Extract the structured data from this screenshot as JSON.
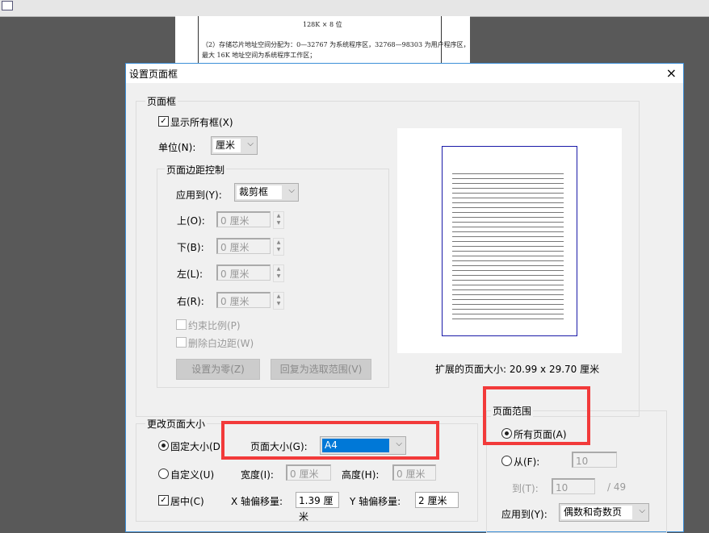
{
  "app": {
    "toolbar_icon": "expand-icon"
  },
  "document": {
    "line1": "128K × 8 位",
    "line2": "（2）存储芯片地址空间分配为：0—32767 为系统程序区，32768—98303 为用户程序区，",
    "line3": "最大 16K 地址空间为系统程序工作区；"
  },
  "dialog": {
    "title": "设置页面框",
    "close": "×",
    "page_box": {
      "group_label": "页面框",
      "show_all": "显示所有框(X)",
      "show_all_checked": true,
      "unit_label": "单位(N):",
      "unit_value": "厘米",
      "margin_group": "页面边距控制",
      "apply_label": "应用到(Y):",
      "apply_value": "裁剪框",
      "margins": [
        {
          "label": "上(O):",
          "value": "0 厘米"
        },
        {
          "label": "下(B):",
          "value": "0 厘米"
        },
        {
          "label": "左(L):",
          "value": "0 厘米"
        },
        {
          "label": "右(R):",
          "value": "0 厘米"
        }
      ],
      "constrain": "约束比例(P)",
      "remove_white": "删除白边距(W)",
      "set_zero": "设置为零(Z)",
      "revert": "回复为选取范围(V)"
    },
    "preview": {
      "size_text": "扩展的页面大小: 20.99 x 29.70 厘米"
    },
    "resize": {
      "group_label": "更改页面大小",
      "fixed": "固定大小(D)",
      "fixed_selected": true,
      "page_size_label": "页面大小(G):",
      "page_size_value": "A4",
      "custom": "自定义(U)",
      "width_label": "宽度(I):",
      "width_value": "0 厘米",
      "height_label": "高度(H):",
      "height_value": "0 厘米",
      "center": "居中(C)",
      "center_checked": true,
      "x_offset_label": "X 轴偏移量:",
      "x_offset_value": "1.39 厘米",
      "y_offset_label": "Y 轴偏移量:",
      "y_offset_value": "2 厘米"
    },
    "page_range": {
      "group_label": "页面范围",
      "all": "所有页面(A)",
      "all_selected": true,
      "from": "从(F):",
      "from_value": "10",
      "to": "到(T):",
      "to_value": "10",
      "total": "/ 49",
      "apply_label": "应用到(Y):",
      "apply_value": "偶数和奇数页"
    },
    "highlight_color": "#f23a3a",
    "accent": "#0078d7"
  }
}
